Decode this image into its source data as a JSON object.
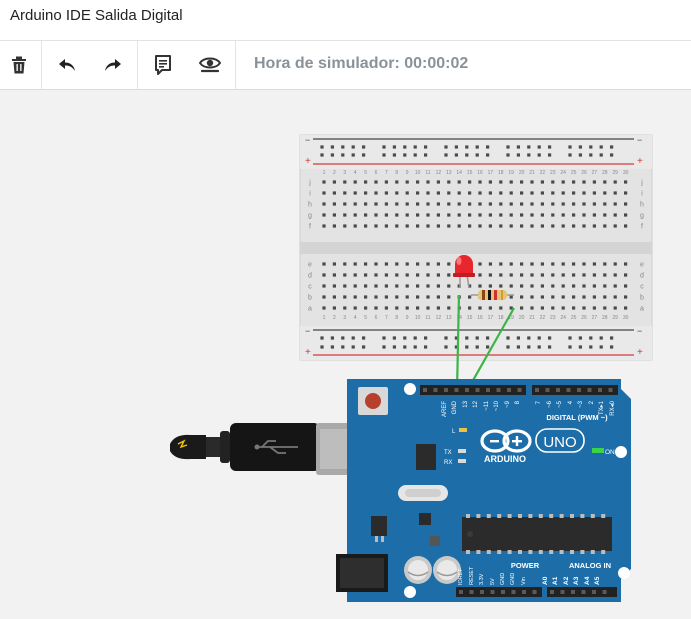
{
  "app": {
    "title": "Arduino IDE Salida Digital"
  },
  "toolbar": {
    "delete_icon": "trash-icon",
    "undo_icon": "undo-icon",
    "redo_icon": "redo-icon",
    "code_icon": "notes-icon",
    "view_icon": "eye-icon",
    "sim_time": "Hora de simulador: 00:00:02"
  },
  "breadboard": {
    "column_numbers": [
      "1",
      "2",
      "3",
      "4",
      "5",
      "6",
      "7",
      "8",
      "9",
      "10",
      "11",
      "12",
      "13",
      "14",
      "15",
      "16",
      "17",
      "18",
      "19",
      "20",
      "21",
      "22",
      "23",
      "24",
      "25",
      "26",
      "27",
      "28",
      "29",
      "30"
    ],
    "top_rows": [
      "j",
      "i",
      "h",
      "g",
      "f"
    ],
    "bottom_rows": [
      "e",
      "d",
      "c",
      "b",
      "a"
    ],
    "rail_minus": "−",
    "rail_plus": "+"
  },
  "arduino": {
    "brand": "ARDUINO",
    "model": "UNO",
    "digital_label": "DIGITAL (PWM ~)",
    "power_label": "POWER",
    "analog_label": "ANALOG IN",
    "on_label": "ON",
    "l_label": "L",
    "tx_label": "TX",
    "rx_label": "RX",
    "top_pins": [
      "AREF",
      "GND",
      "13",
      "12",
      "~11",
      "~10",
      "~9",
      "8",
      "7",
      "~6",
      "~5",
      "4",
      "~3",
      "2",
      "TX▸1",
      "RX◂0"
    ],
    "power_pins": [
      "IOREF",
      "RESET",
      "3.3V",
      "5V",
      "GND",
      "GND",
      "Vin"
    ],
    "analog_pins": [
      "A0",
      "A1",
      "A2",
      "A3",
      "A4",
      "A5"
    ]
  },
  "colors": {
    "board_blue": "#1d6ea8",
    "wire_green": "#3cb446",
    "led_red": "#e8262d",
    "rail_red": "#d23b3b"
  }
}
